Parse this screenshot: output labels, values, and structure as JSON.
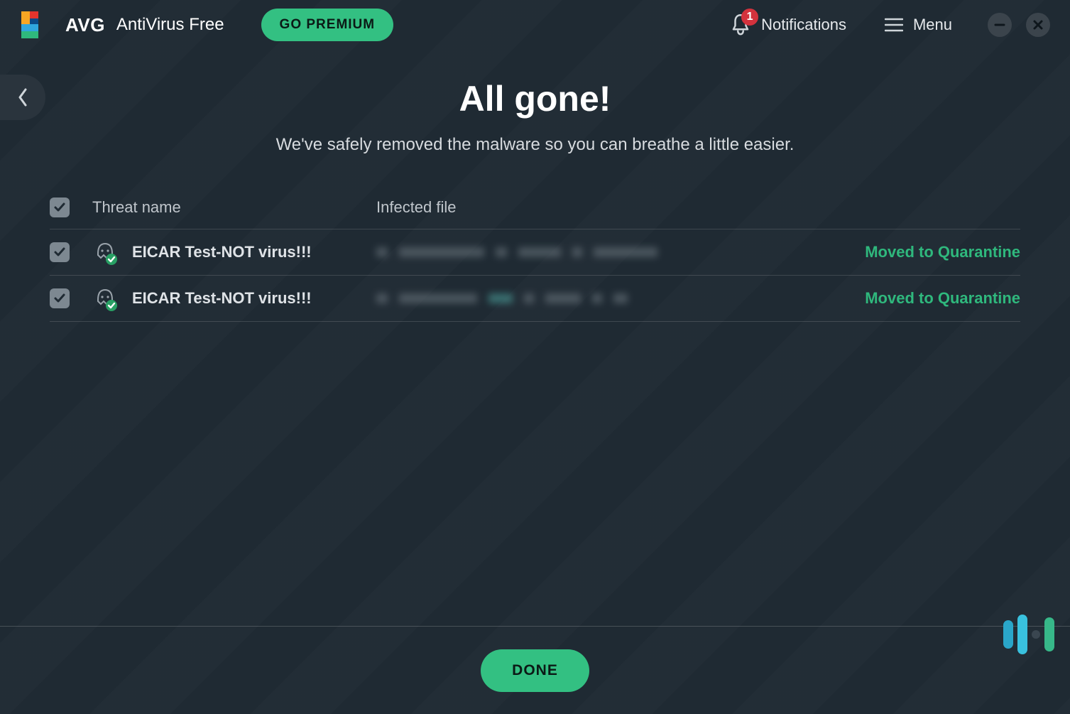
{
  "header": {
    "brand": "AVG",
    "product": "AntiVirus Free",
    "go_premium": "GO PREMIUM",
    "notifications_label": "Notifications",
    "notifications_count": "1",
    "menu_label": "Menu"
  },
  "main": {
    "title": "All gone!",
    "subtitle": "We've safely removed the malware so you can breathe a little easier."
  },
  "table": {
    "col_threat": "Threat name",
    "col_file": "Infected file",
    "rows": [
      {
        "threat": "EICAR Test-NOT virus!!!",
        "status": "Moved to Quarantine"
      },
      {
        "threat": "EICAR Test-NOT virus!!!",
        "status": "Moved to Quarantine"
      }
    ]
  },
  "footer": {
    "done": "DONE"
  },
  "colors": {
    "accent_green": "#33c082",
    "status_green": "#2fb87d",
    "badge_red": "#d3323d"
  }
}
